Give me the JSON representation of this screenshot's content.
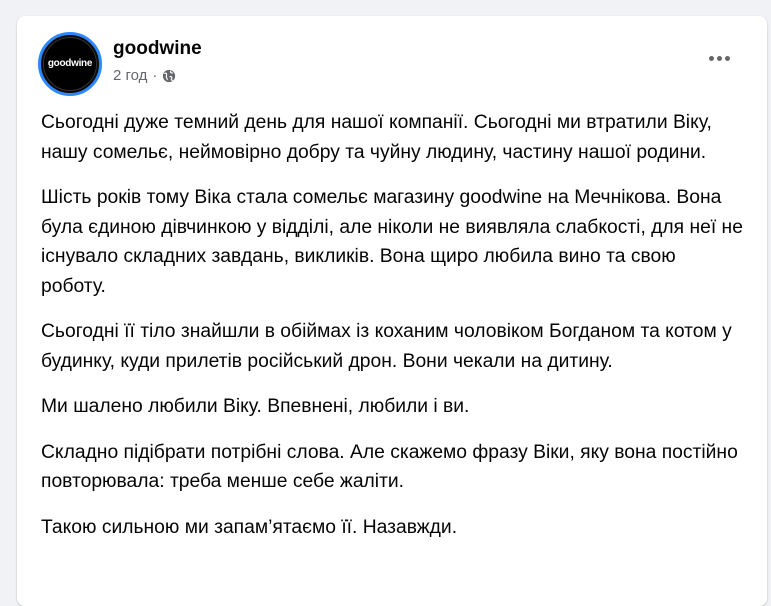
{
  "post": {
    "author": "goodwine",
    "time": "2 год",
    "separator": "·",
    "privacy_icon": "globe-icon",
    "more_icon": "more-options-icon",
    "avatar": {
      "logo_text": "goodwine",
      "logo_subtext": "",
      "ring_color": "#2d88ff"
    },
    "paragraphs": [
      "Сьогодні дуже темний день для нашої компанії. Сьогодні ми втратили Віку, нашу сомельє, неймовірно добру та чуйну людину, частину нашої родини.",
      "Шість років тому Віка стала сомельє магазину goodwine на Мечнікова. Вона була єдиною дівчинкою у відділі, але ніколи не виявляла слабкості, для неї не існувало складних завдань, викликів. Вона щиро любила вино та свою роботу.",
      "Сьогодні її тіло знайшли в обіймах із коханим чоловіком Богданом та котом у будинку, куди прилетів російський дрон. Вони чекали на дитину.",
      "Ми шалено любили Віку. Впевнені, любили і ви.",
      "Складно підібрати потрібні слова. Але скажемо фразу Віки, яку вона постійно повторювала: треба менше себе жаліти.",
      "Такою сильною ми запам’ятаємо її. Назавжди."
    ]
  }
}
